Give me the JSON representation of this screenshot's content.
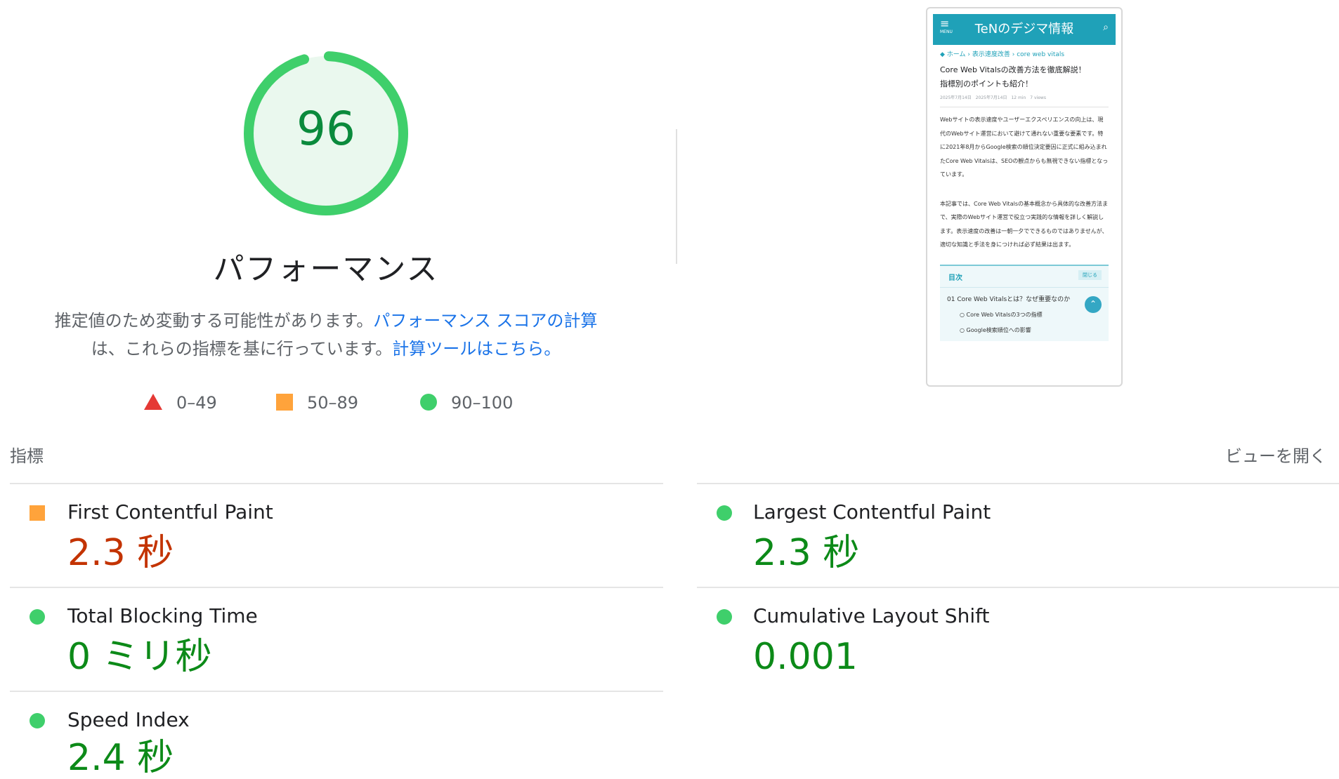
{
  "score": {
    "value": 96,
    "fraction": 0.96,
    "color": "#3fcf6b",
    "fill_color": "#eaf8ee",
    "text_color": "#0a8a3c"
  },
  "category_title": "パフォーマンス",
  "description": {
    "text1": "推定値のため変動する可能性があります。",
    "link1": "パフォーマンス スコアの計算",
    "text2": "は、これらの指標を基に行っています。",
    "link2": "計算ツールはこちら。",
    "link_color": "#1a73e8"
  },
  "legend": [
    {
      "icon": "red-triangle",
      "label": "0–49",
      "color": "#e53935"
    },
    {
      "icon": "orange-square",
      "label": "50–89",
      "color": "#ffa33b"
    },
    {
      "icon": "green-circle",
      "label": "90–100",
      "color": "#3fcf6b"
    }
  ],
  "thumbnail": {
    "menu_icon": "≡",
    "menu_label": "MENU",
    "site_title": "TeNのデジマ情報",
    "breadcrumb": [
      "ホーム",
      "表示速度改善",
      "core web vitals"
    ],
    "article_title_line1": "Core Web Vitalsの改善方法を徹底解説！",
    "article_title_line2": "指標別のポイントも紹介！",
    "meta": "2025年7月14日　2025年7月14日　12 min　7 views",
    "para1": "Webサイトの表示速度やユーザーエクスペリエンスの向上は、現代のWebサイト運営において避けて通れない重要な要素です。特に2021年8月からGoogle検索の順位決定要因に正式に組み込まれたCore Web Vitalsは、SEOの観点からも無視できない指標となっています。",
    "para2": "本記事では、Core Web Vitalsの基本概念から具体的な改善方法まで、実際のWebサイト運営で役立つ実践的な情報を詳しく解説します。表示速度の改善は一朝一夕でできるものではありませんが、適切な知識と手法を身につければ必ず結果は出ます。",
    "toc_heading": "目次",
    "toc_close": "閉じる",
    "toc_items": [
      "01  Core Web Vitalsとは？なぜ重要なのか",
      "Core Web Vitalsの3つの指標",
      "Google検索順位への影響"
    ],
    "header_color": "#1fa1b8"
  },
  "metrics_section": {
    "label": "指標",
    "expand_label": "ビューを開く"
  },
  "metrics": [
    {
      "name": "First Contentful Paint",
      "value": "2.3 秒",
      "status": "average"
    },
    {
      "name": "Largest Contentful Paint",
      "value": "2.3 秒",
      "status": "good"
    },
    {
      "name": "Total Blocking Time",
      "value": "0 ミリ秒",
      "status": "good"
    },
    {
      "name": "Cumulative Layout Shift",
      "value": "0.001",
      "status": "good"
    },
    {
      "name": "Speed Index",
      "value": "2.4 秒",
      "status": "good"
    }
  ],
  "status_colors": {
    "good_icon": "#3fcf6b",
    "good_text": "#0c8a18",
    "average_icon": "#ffa33b",
    "average_text": "#c33300"
  }
}
